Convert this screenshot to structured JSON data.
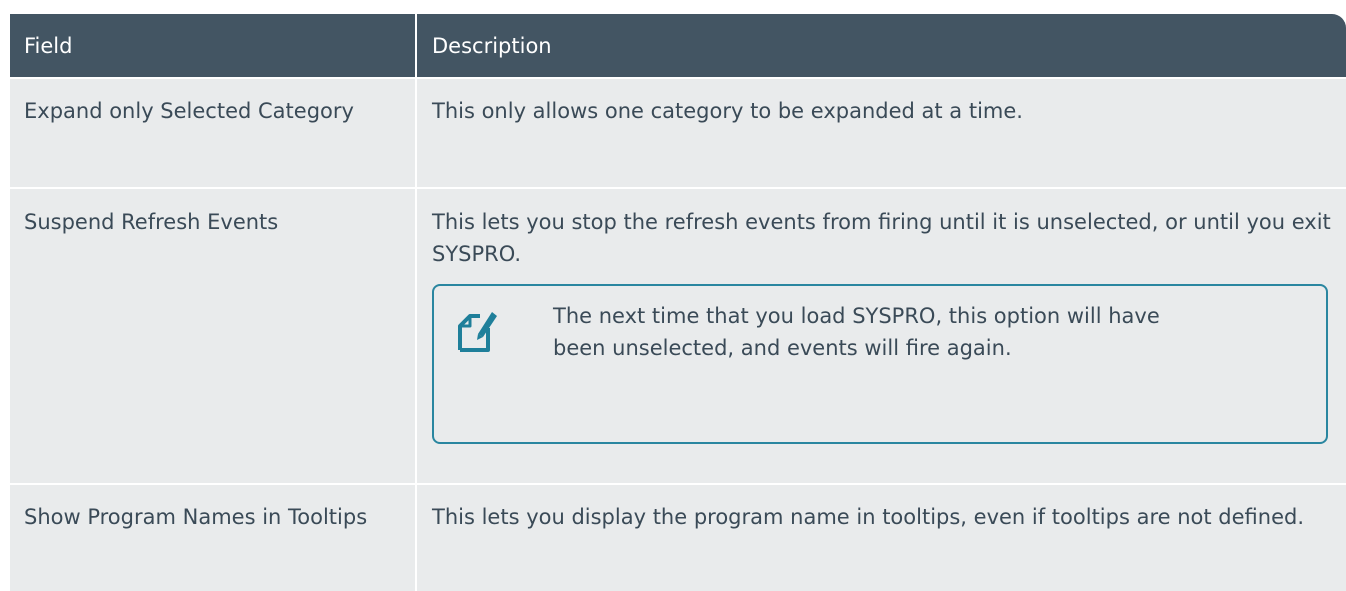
{
  "table": {
    "header": {
      "field": "Field",
      "description": "Description"
    },
    "rows": [
      {
        "field": "Expand only Selected Category",
        "description": "This only allows one category to be expanded at a time."
      },
      {
        "field": "Suspend Refresh Events",
        "description": "This lets you stop the refresh events from firing until it is unselected, or until you exit SYSPRO.",
        "note": {
          "icon": "note-pencil-icon",
          "text": "The next time that you load SYSPRO, this option will have been unselected, and events will fire again.",
          "border_color": "#2a86a0"
        }
      },
      {
        "field": "Show Program Names in Tooltips",
        "description": "This lets you display the program name in tooltips, even if tooltips are not defined."
      }
    ]
  },
  "colors": {
    "header_bg": "#435563",
    "row_bg": "#e9ebec",
    "text": "#3a4a57",
    "icon": "#1f7f9a"
  }
}
